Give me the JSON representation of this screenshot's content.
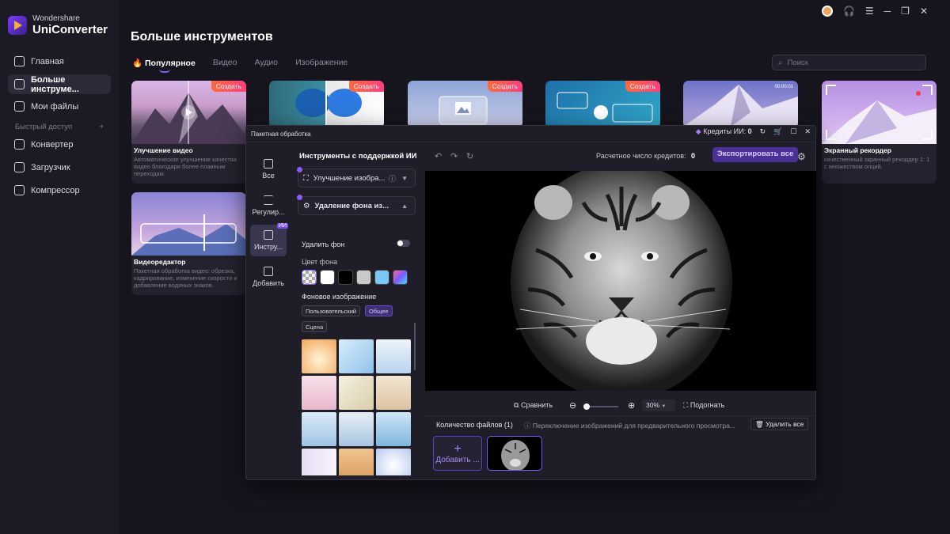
{
  "app": {
    "brand_small": "Wondershare",
    "brand_name": "UniConverter"
  },
  "sidebar": {
    "items": [
      {
        "label": "Главная"
      },
      {
        "label": "Больше инструме..."
      },
      {
        "label": "Мои файлы"
      }
    ],
    "quick_access": "Быстрый доступ",
    "quick_add": "+",
    "tools": [
      {
        "label": "Конвертер"
      },
      {
        "label": "Загрузчик"
      },
      {
        "label": "Компрессор"
      }
    ]
  },
  "header": {
    "title": "Больше инструментов",
    "search_placeholder": "Поиск"
  },
  "tabs": [
    {
      "label": "Популярное"
    },
    {
      "label": "Видео"
    },
    {
      "label": "Аудио"
    },
    {
      "label": "Изображение"
    }
  ],
  "cards": [
    {
      "badge": "Создать",
      "title": "Улучшение видео",
      "desc": "Автоматическое улучшение качества видео благодаря более плавным переходам."
    },
    {
      "badge": "Создать"
    },
    {
      "badge": "Создать"
    },
    {
      "badge": "Создать"
    },
    {
      "timecode": "00:00:01"
    },
    {
      "title": "Экранный рекордер",
      "desc": "качественный экранный рекордер 1: 1 с множеством опций."
    },
    {
      "title": "Видеоредактор",
      "desc": "Пакетная обработка видео: обрезка, кадрирование, изменение скорости и добавление водяных знаков."
    }
  ],
  "dialog": {
    "title": "Пакетная обработка",
    "credits_label": "Кредиты ИИ:",
    "credits_value": "0",
    "rail": [
      {
        "label": "Все"
      },
      {
        "label": "Регулир..."
      },
      {
        "label": "Инстру...",
        "tag": "ИИ"
      },
      {
        "label": "Добавить"
      }
    ],
    "panel": {
      "title": "Инструменты с поддержкой ИИ",
      "dropdown1": "Улучшение изобра...",
      "dropdown2": "Удаление фона из...",
      "remove_bg": "Удалить фон",
      "bg_color": "Цвет фона",
      "bg_image": "Фоновое изображение",
      "chips": [
        "Пользовательский",
        "Общее",
        "Сцена"
      ]
    },
    "toolbar": {
      "estimate_label": "Расчетное число кредитов:",
      "estimate_value": "0",
      "export": "Экспортировать все"
    },
    "controls": {
      "compare": "Сравнить",
      "zoom": "30%",
      "fit": "Подогнать"
    },
    "files": {
      "count": "Количество файлов (1)",
      "hint": "Переключение изображений для предварительного просмотра...",
      "delete_all": "Удалить все",
      "add": "Добавить ..."
    }
  },
  "colors": {
    "accent": "#8b5cf6",
    "badge": "#ff4d6d",
    "bg": "#16151e"
  }
}
